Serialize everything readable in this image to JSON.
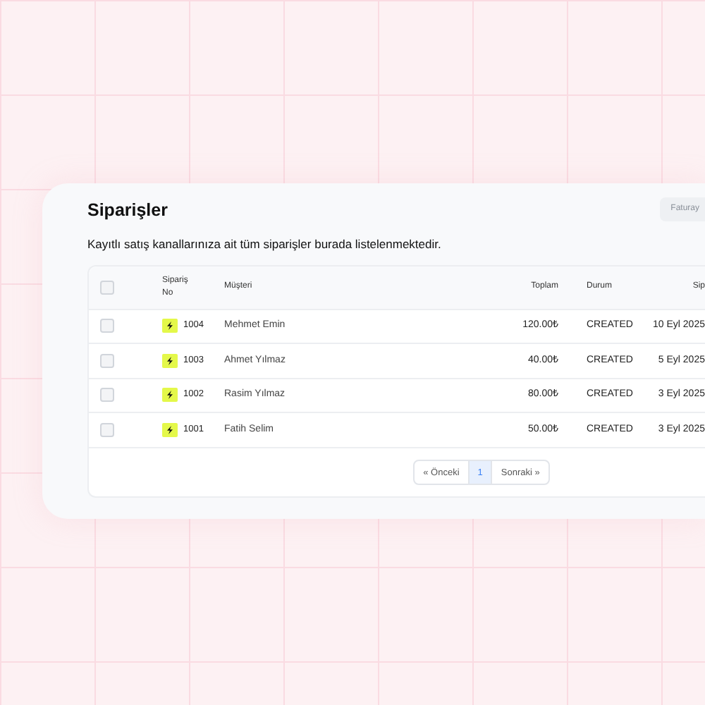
{
  "page": {
    "title": "Siparişler",
    "action_button": "Faturay",
    "description": "Kayıtlı satış kanallarınıza ait tüm siparişler burada listelenmektedir."
  },
  "table": {
    "select_all": {
      "checked": false
    },
    "columns": [
      "Sipariş No",
      "Müşteri",
      "Toplam",
      "Durum",
      "Sip"
    ],
    "rows": [
      {
        "checked": false,
        "order_no": "1004",
        "customer": "Mehmet Emin",
        "total": "120.00₺",
        "status": "CREATED",
        "date": "10 Eyl 2025"
      },
      {
        "checked": false,
        "order_no": "1003",
        "customer": "Ahmet Yılmaz",
        "total": "40.00₺",
        "status": "CREATED",
        "date": "5 Eyl 2025"
      },
      {
        "checked": false,
        "order_no": "1002",
        "customer": "Rasim Yılmaz",
        "total": "80.00₺",
        "status": "CREATED",
        "date": "3 Eyl 2025"
      },
      {
        "checked": false,
        "order_no": "1001",
        "customer": "Fatih Selim",
        "total": "50.00₺",
        "status": "CREATED",
        "date": "3 Eyl 2025"
      }
    ]
  },
  "pagination": {
    "previous": "« Önceki",
    "pages": [
      {
        "label": "1",
        "selected": true
      }
    ],
    "next": "Sonraki »"
  }
}
